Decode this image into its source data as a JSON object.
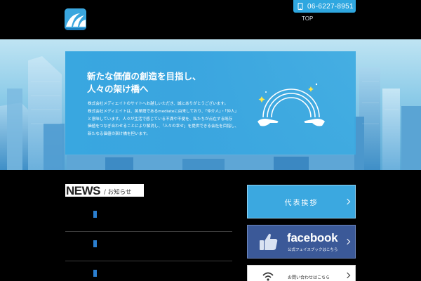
{
  "header": {
    "phone_number": "06-6227-8951",
    "nav_top": "TOP",
    "logo_icon": "company-logo"
  },
  "hero": {
    "headline_line1": "新たな価値の創造を目指し、",
    "headline_line2": "人々の架け橋へ",
    "body_lines": [
      "株式会社メディエイトのサイトへお越しいただき、誠にありがとうございます。",
      "株式会社メディエイトは、英単語であるmediateに由来しており、「仲介人」・「仲人」",
      "と意味しています。人々が生活で感じている不満や不便を、私たちが点在する既存",
      "価値をつなぎ合わせることにより解消し、「人々の幸せ」を提供できる会社を目指し、",
      "新たなる価値の架け橋を担います。"
    ],
    "illustration_icon": "rainbow-hands-illustration"
  },
  "news": {
    "title": "NEWS",
    "subtitle": "/ お知らせ",
    "items": [
      {
        "marker": "blue"
      },
      {
        "marker": "blue"
      },
      {
        "marker": "blue"
      }
    ]
  },
  "sidebar": {
    "greeting_label": "代表挨拶",
    "facebook_word": "facebook",
    "facebook_sub": "公式フェイスブックはこちら",
    "contact_label": "お問い合わせはこちら"
  },
  "colors": {
    "accent": "#2fa7e0",
    "facebook": "#3b5998",
    "background": "#000000"
  }
}
